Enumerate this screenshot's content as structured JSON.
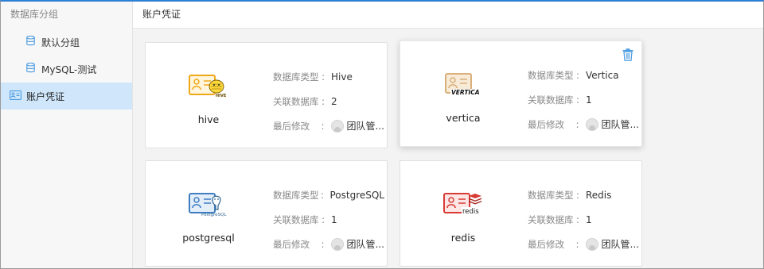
{
  "sidebar": {
    "header": "数据库分组",
    "items": [
      {
        "label": "默认分组",
        "icon": "database-icon"
      },
      {
        "label": "MySQL-测试",
        "icon": "database-icon"
      },
      {
        "label": "账户凭证",
        "icon": "id-card-icon",
        "active": true
      }
    ]
  },
  "main": {
    "title": "账户凭证"
  },
  "labels": {
    "db_type": "数据库类型",
    "linked_db": "关联数据库",
    "last_modified": "最后修改",
    "colon": ":"
  },
  "cards": [
    {
      "name": "hive",
      "type": "Hive",
      "linked": "2",
      "modifier": "团队管...",
      "logo_text": "HIVE",
      "color": "#f0a818"
    },
    {
      "name": "vertica",
      "type": "Vertica",
      "linked": "1",
      "modifier": "团队管...",
      "logo_text": "VERTICA",
      "color": "#d9b07a"
    },
    {
      "name": "postgresql",
      "type": "PostgreSQL",
      "linked": "1",
      "modifier": "团队管...",
      "logo_text": "PostgreSQL",
      "color": "#3f7dc2"
    },
    {
      "name": "redis",
      "type": "Redis",
      "linked": "1",
      "modifier": "团队管...",
      "logo_text": "redis",
      "color": "#d83a34"
    }
  ],
  "colors": {
    "accent": "#2d7fd3",
    "active_bg": "#cfe6fb",
    "trash": "#4a9be0"
  }
}
